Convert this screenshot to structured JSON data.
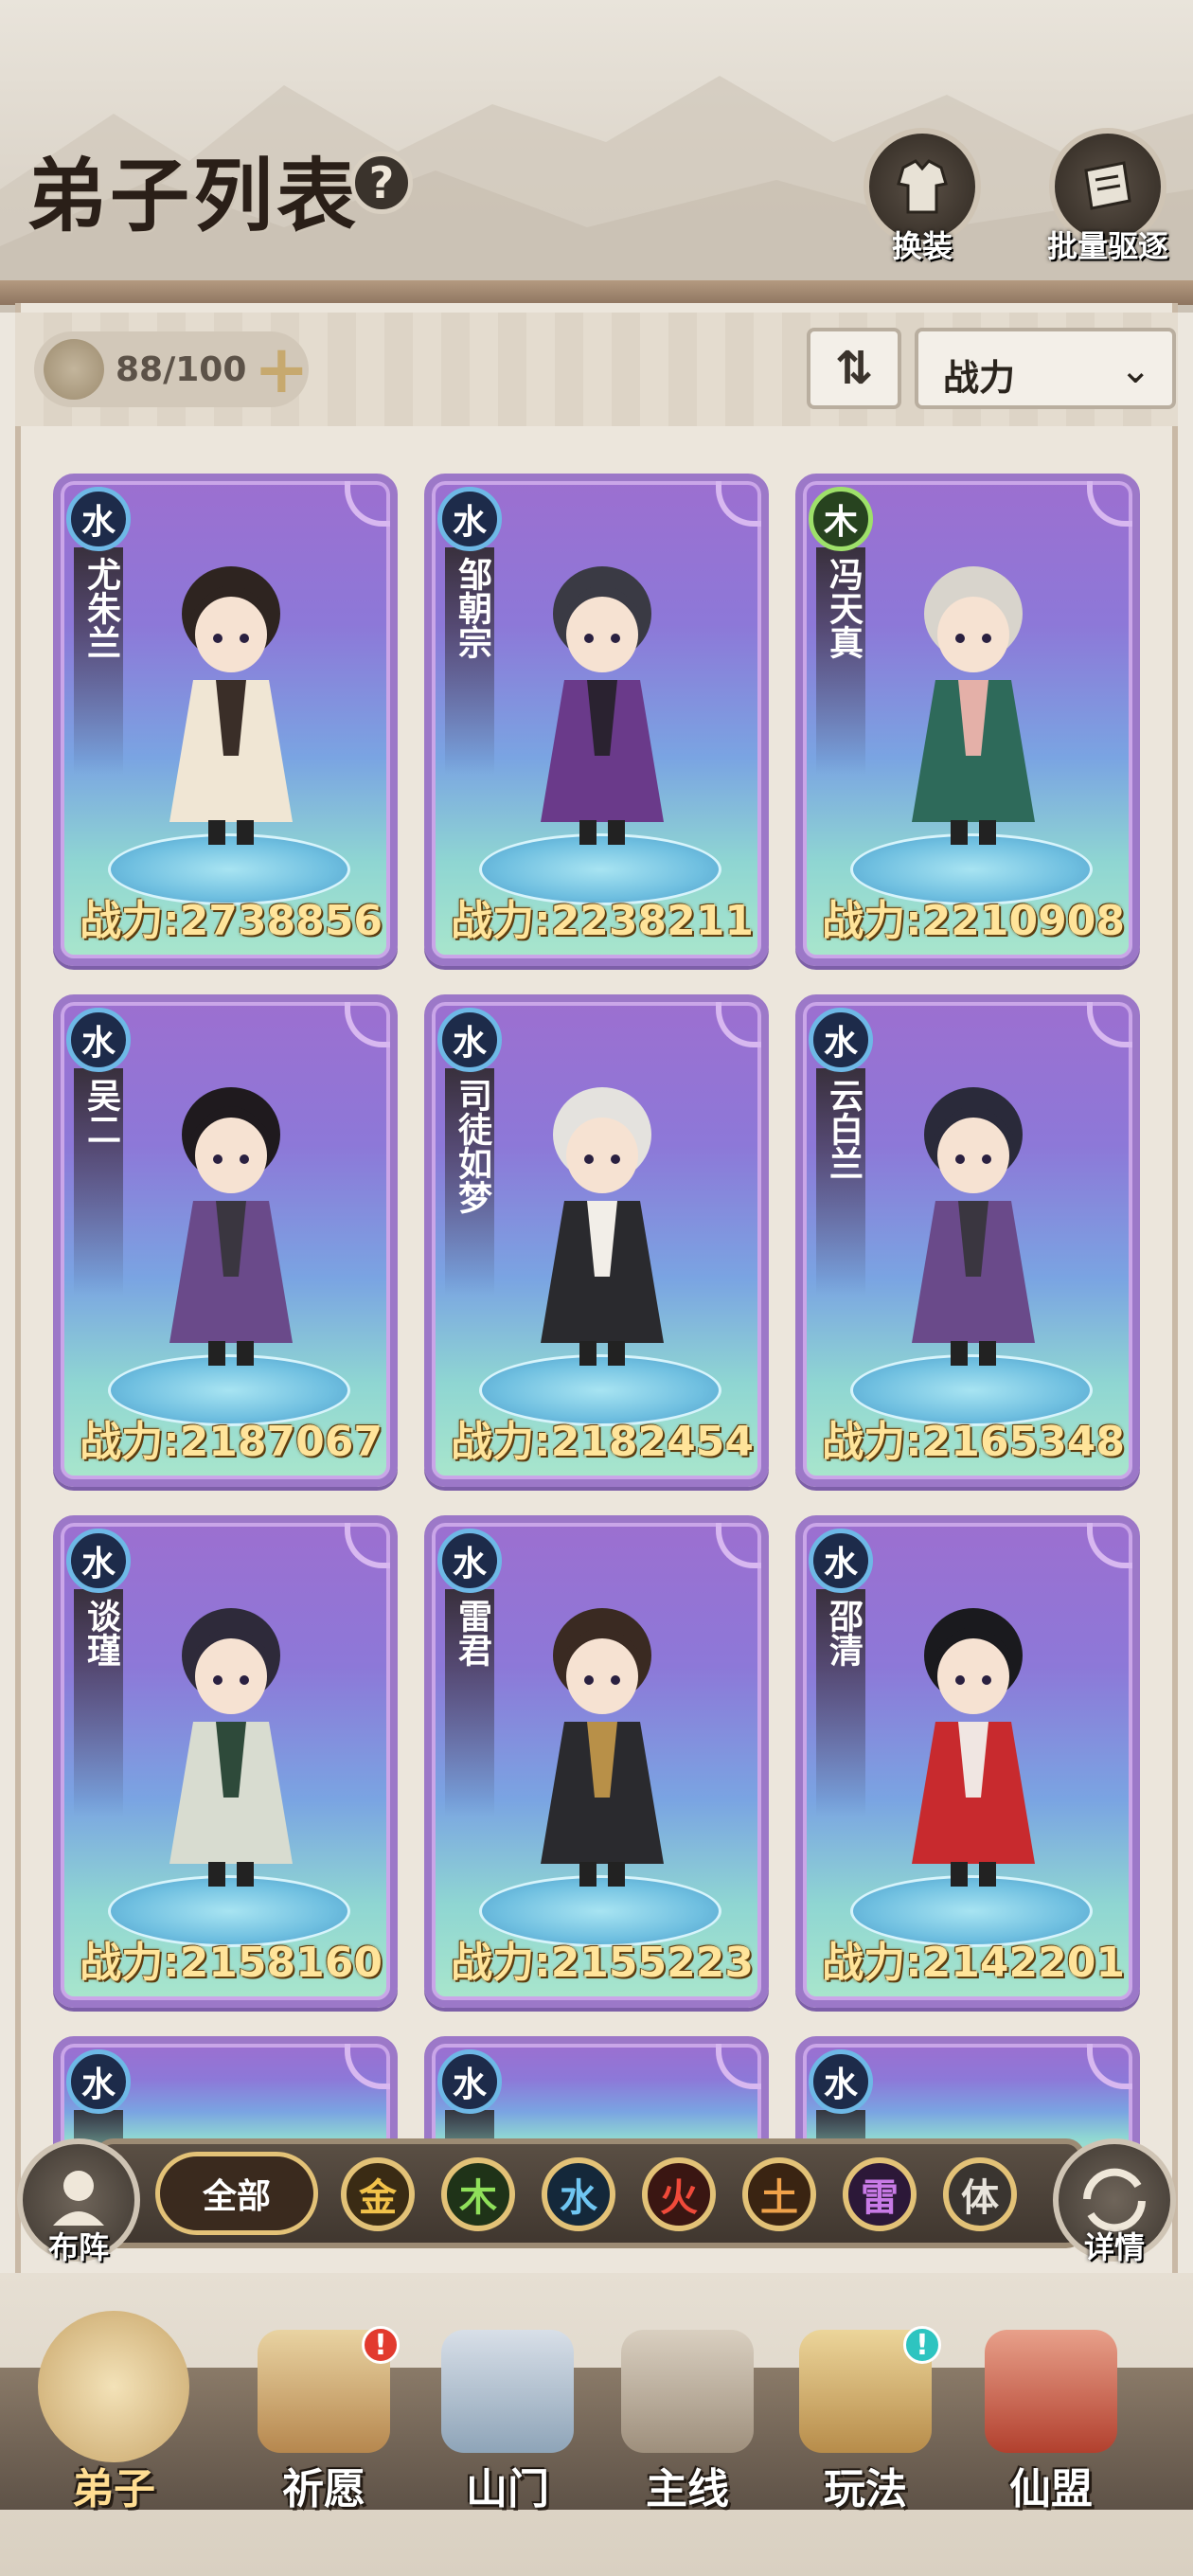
{
  "header": {
    "title": "弟子列表",
    "help_icon": "?",
    "buttons": [
      {
        "label": "换装",
        "icon": "outfit-icon"
      },
      {
        "label": "批量驱逐",
        "icon": "expel-icon"
      }
    ]
  },
  "toolbar": {
    "capacity": "88/100",
    "plus": "+",
    "sort_icon": "⇅",
    "sort_select": {
      "value": "战力",
      "chevron": "⌄"
    }
  },
  "disciples": [
    {
      "element": "水",
      "name": "尤朱兰",
      "power": "战力:2738856"
    },
    {
      "element": "水",
      "name": "邹朝宗",
      "power": "战力:2238211"
    },
    {
      "element": "木",
      "name": "冯天真",
      "power": "战力:2210908"
    },
    {
      "element": "水",
      "name": "吴二",
      "power": "战力:2187067"
    },
    {
      "element": "水",
      "name": "司徒如梦",
      "power": "战力:2182454"
    },
    {
      "element": "水",
      "name": "云白兰",
      "power": "战力:2165348"
    },
    {
      "element": "水",
      "name": "谈瑾",
      "power": "战力:2158160"
    },
    {
      "element": "水",
      "name": "雷君",
      "power": "战力:2155223"
    },
    {
      "element": "水",
      "name": "邵清",
      "power": "战力:2142201"
    },
    {
      "element": "水"
    },
    {
      "element": "水"
    },
    {
      "element": "水"
    }
  ],
  "filter": {
    "left_button": "布阵",
    "right_button": "详情",
    "all": "全部",
    "elements": [
      {
        "label": "金",
        "color": "#f2c24a",
        "bg": "#3a2b14"
      },
      {
        "label": "木",
        "color": "#8fe05a",
        "bg": "#1f3318"
      },
      {
        "label": "水",
        "color": "#6fc6f2",
        "bg": "#14283a"
      },
      {
        "label": "火",
        "color": "#f04a3a",
        "bg": "#3a1612"
      },
      {
        "label": "土",
        "color": "#f0a24a",
        "bg": "#3a2412"
      },
      {
        "label": "雷",
        "color": "#c87ae6",
        "bg": "#2c1838"
      },
      {
        "label": "体",
        "color": "#e8e4dc",
        "bg": "#3a3530"
      }
    ]
  },
  "nav": [
    {
      "label": "弟子",
      "active": true,
      "badge": ""
    },
    {
      "label": "祈愿",
      "active": false,
      "badge": "!"
    },
    {
      "label": "山门",
      "active": false,
      "badge": ""
    },
    {
      "label": "主线",
      "active": false,
      "badge": ""
    },
    {
      "label": "玩法",
      "active": false,
      "badge": "!"
    },
    {
      "label": "仙盟",
      "active": false,
      "badge": ""
    }
  ],
  "colors": {
    "accent_gold": "#ffe49a",
    "card_border": "#9c78c8",
    "badge_red": "#e23a2e",
    "badge_teal": "#2ec4c0"
  }
}
